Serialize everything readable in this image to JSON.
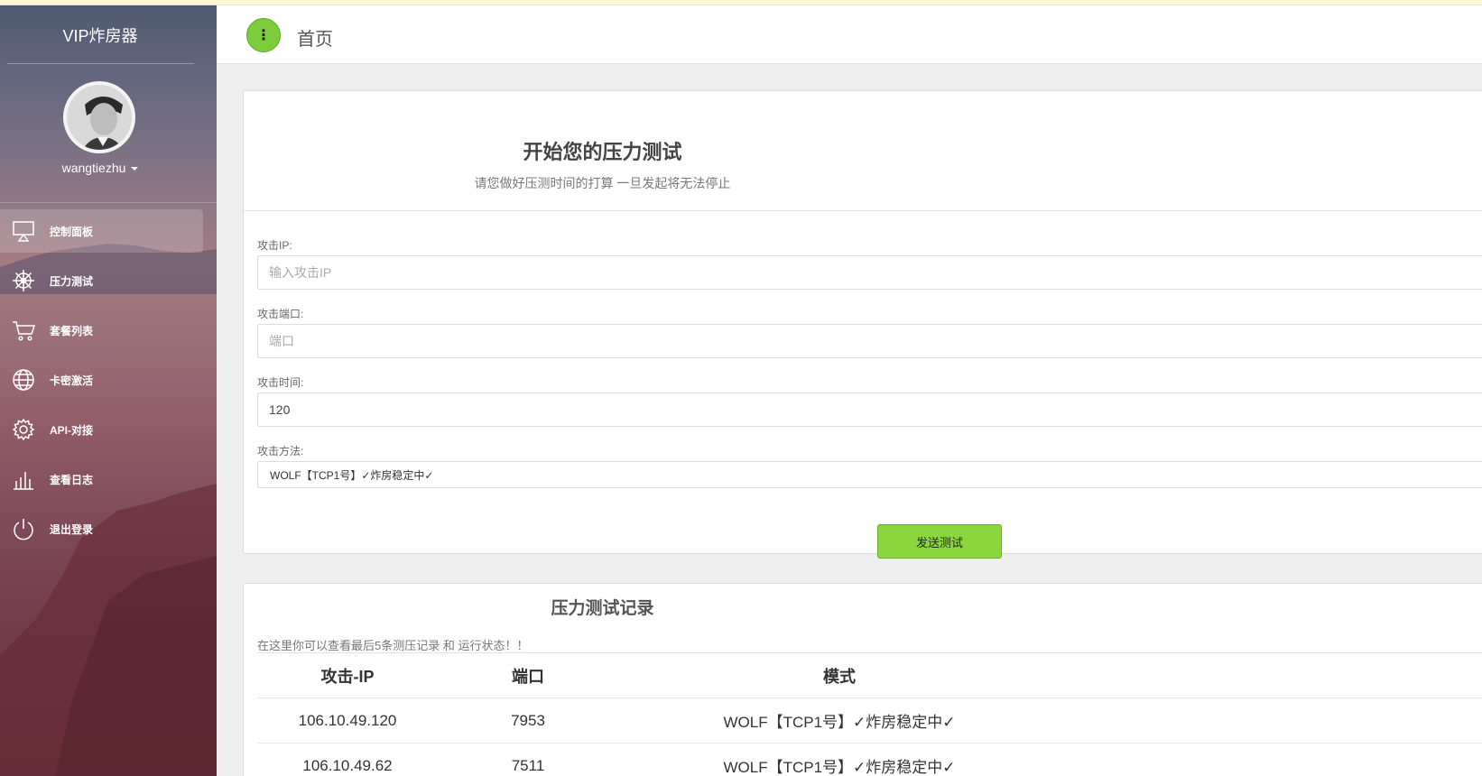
{
  "app": {
    "brand": "VIP炸房器"
  },
  "user": {
    "name": "wangtiezhu"
  },
  "sidebar": {
    "items": [
      {
        "label": "控制面板",
        "icon": "monitor-icon",
        "active": true
      },
      {
        "label": "压力测试",
        "icon": "ship-wheel-icon",
        "active": false
      },
      {
        "label": "套餐列表",
        "icon": "cart-icon",
        "active": false
      },
      {
        "label": "卡密激活",
        "icon": "globe-icon",
        "active": false
      },
      {
        "label": "API-对接",
        "icon": "gear-icon",
        "active": false
      },
      {
        "label": "查看日志",
        "icon": "bar-chart-icon",
        "active": false
      },
      {
        "label": "退出登录",
        "icon": "power-icon",
        "active": false
      }
    ]
  },
  "header": {
    "menu_icon": "⋮",
    "title": "首页"
  },
  "form": {
    "title": "开始您的压力测试",
    "subtitle": "请您做好压测时间的打算 一旦发起将无法停止",
    "ip": {
      "label": "攻击IP:",
      "placeholder": "输入攻击IP",
      "value": ""
    },
    "port": {
      "label": "攻击端口:",
      "placeholder": "端口",
      "value": ""
    },
    "time": {
      "label": "攻击时间:",
      "value": "120"
    },
    "method": {
      "label": "攻击方法:",
      "selected": "WOLF【TCP1号】✓炸房稳定中✓"
    },
    "submit_label": "发送测试"
  },
  "records": {
    "title": "压力测试记录",
    "note": "在这里你可以查看最后5条测压记录 和 运行状态！！",
    "columns": [
      "攻击-IP",
      "端口",
      "模式"
    ],
    "rows": [
      {
        "ip": "106.10.49.120",
        "port": "7953",
        "mode": "WOLF【TCP1号】✓炸房稳定中✓"
      },
      {
        "ip": "106.10.49.62",
        "port": "7511",
        "mode": "WOLF【TCP1号】✓炸房稳定中✓"
      }
    ]
  },
  "colors": {
    "accent_green": "#8bd63e",
    "menu_button_green": "#7ccc3b"
  }
}
